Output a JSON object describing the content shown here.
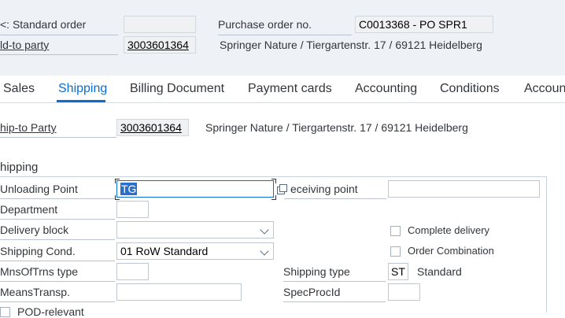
{
  "header": {
    "order_type_label": "<: Standard order",
    "order_type_value": "",
    "po_label": "Purchase order no.",
    "po_value": "C0013368 - PO SPR1",
    "sold_to_label": "ld-to party",
    "sold_to_value": "3003601364",
    "sold_to_address": "Springer Nature / Tiergartenstr. 17 / 69121 Heidelberg"
  },
  "tabs": [
    {
      "label": "Sales"
    },
    {
      "label": "Shipping"
    },
    {
      "label": "Billing Document"
    },
    {
      "label": "Payment cards"
    },
    {
      "label": "Accounting"
    },
    {
      "label": "Conditions"
    },
    {
      "label": "Account"
    }
  ],
  "active_tab": "Shipping",
  "ship_to": {
    "label": "hip-to Party",
    "value": "3003601364",
    "address": "Springer Nature / Tiergartenstr. 17 / 69121 Heidelberg"
  },
  "shipping": {
    "section_title": "hipping",
    "unloading_point_label": "Unloading Point",
    "unloading_point_value": "TG",
    "receiving_point_label": "eceiving point",
    "receiving_point_value": "",
    "department_label": "Department",
    "department_value": "",
    "delivery_block_label": "Delivery block",
    "delivery_block_value": "",
    "shipping_cond_label": "Shipping Cond.",
    "shipping_cond_value": "01 RoW Standard",
    "complete_delivery_label": "Complete delivery",
    "complete_delivery_checked": false,
    "order_combination_label": "Order Combination",
    "order_combination_checked": false,
    "mns_of_trns_type_label": "MnsOfTrns type",
    "mns_of_trns_type_value": "",
    "shipping_type_label": "Shipping type",
    "shipping_type_code": "ST",
    "shipping_type_text": "Standard",
    "means_transp_label": "MeansTransp.",
    "means_transp_value": "",
    "spec_proc_id_label": "SpecProcId",
    "spec_proc_id_value": "",
    "pod_relevant_label": "POD-relevant"
  },
  "colors": {
    "accent": "#0a6ed1",
    "header_band": "#eef2f7",
    "selection": "#2a6fc9"
  }
}
